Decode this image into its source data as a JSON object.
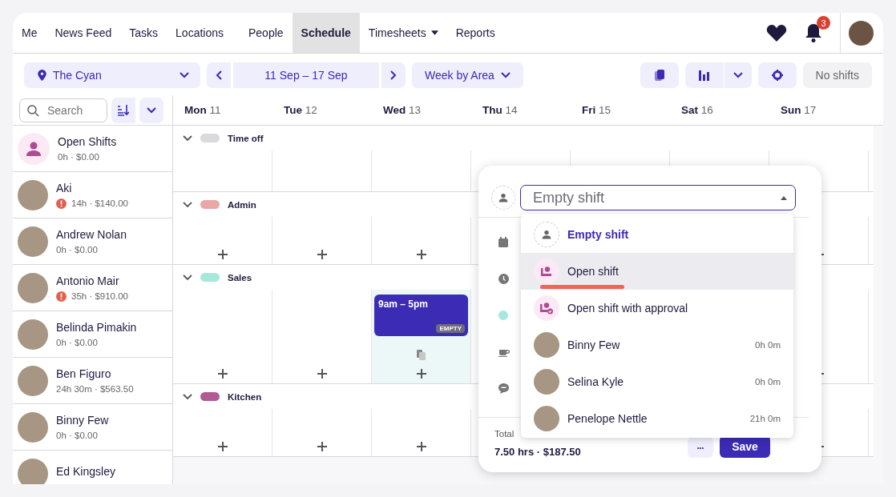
{
  "nav": {
    "items": [
      {
        "label": "Me",
        "selected": false,
        "has_caret": false
      },
      {
        "label": "News Feed",
        "selected": false,
        "has_caret": false
      },
      {
        "label": "Tasks",
        "selected": false,
        "has_caret": false
      },
      {
        "label": "Locations",
        "selected": false,
        "has_caret": false
      },
      {
        "label": "People",
        "selected": false,
        "has_caret": false
      },
      {
        "label": "Schedule",
        "selected": true,
        "has_caret": false
      },
      {
        "label": "Timesheets",
        "selected": false,
        "has_caret": true
      },
      {
        "label": "Reports",
        "selected": false,
        "has_caret": false
      }
    ],
    "notification_count": "3"
  },
  "toolbar": {
    "location": "The Cyan",
    "date_range": "11 Sep – 17 Sep",
    "view": "Week by Area",
    "status": "No shifts"
  },
  "search": {
    "placeholder": "Search"
  },
  "days": [
    {
      "day": "Mon",
      "date": "11"
    },
    {
      "day": "Tue",
      "date": "12"
    },
    {
      "day": "Wed",
      "date": "13"
    },
    {
      "day": "Thu",
      "date": "14"
    },
    {
      "day": "Fri",
      "date": "15"
    },
    {
      "day": "Sat",
      "date": "16"
    },
    {
      "day": "Sun",
      "date": "17"
    }
  ],
  "staff": [
    {
      "kind": "open",
      "name": "Open Shifts",
      "summary": "0h · $0.00",
      "warning": false
    },
    {
      "kind": "person",
      "name": "Aki",
      "summary": "14h · $140.00",
      "warning": true
    },
    {
      "kind": "person",
      "name": "Andrew Nolan",
      "summary": "0h · $0.00",
      "warning": false
    },
    {
      "kind": "person",
      "name": "Antonio Mair",
      "summary": "35h · $910.00",
      "warning": true
    },
    {
      "kind": "person",
      "name": "Belinda Pimakin",
      "summary": "0h · $0.00",
      "warning": false
    },
    {
      "kind": "person",
      "name": "Ben Figuro",
      "summary": "24h 30m · $563.50",
      "warning": false
    },
    {
      "kind": "person",
      "name": "Binny Few",
      "summary": "0h · $0.00",
      "warning": false
    },
    {
      "kind": "person",
      "name": "Ed Kingsley",
      "warning": false
    }
  ],
  "areas": [
    {
      "name": "Time off",
      "color": "#d9d9de",
      "expanded": true,
      "addable": false
    },
    {
      "name": "Admin",
      "color": "#e8a8a8",
      "expanded": true,
      "addable": true
    },
    {
      "name": "Sales",
      "color": "#a8e8dc",
      "expanded": true,
      "addable": true,
      "cells": [
        {
          "kind": "blank"
        },
        {
          "kind": "blank"
        },
        {
          "kind": "shift",
          "time": "9am – 5pm",
          "badge": "EMPTY"
        },
        {
          "kind": "blank"
        },
        {
          "kind": "blank"
        },
        {
          "kind": "blank"
        },
        {
          "kind": "blank"
        }
      ]
    },
    {
      "name": "Kitchen",
      "color": "#b25a93",
      "expanded": true,
      "addable": true
    }
  ],
  "popup": {
    "assignee": "Empty shift",
    "total_label": "Total",
    "total": "7.50 hrs · $187.50",
    "more": "•••",
    "save": "Save",
    "options": [
      {
        "kind": "empty",
        "label": "Empty shift",
        "selected": true,
        "highlighted": false,
        "underlined": false
      },
      {
        "kind": "open",
        "label": "Open shift",
        "selected": false,
        "highlighted": true,
        "underlined": true
      },
      {
        "kind": "approval",
        "label": "Open shift with approval",
        "selected": false,
        "highlighted": false,
        "underlined": false
      },
      {
        "kind": "person",
        "label": "Binny Few",
        "hours": "0h 0m",
        "selected": false,
        "highlighted": false,
        "underlined": false
      },
      {
        "kind": "person",
        "label": "Selina Kyle",
        "hours": "0h 0m",
        "selected": false,
        "highlighted": false,
        "underlined": false
      },
      {
        "kind": "person",
        "label": "Penelope Nettle",
        "hours": "21h 0m",
        "selected": false,
        "highlighted": false,
        "underlined": false
      }
    ]
  }
}
